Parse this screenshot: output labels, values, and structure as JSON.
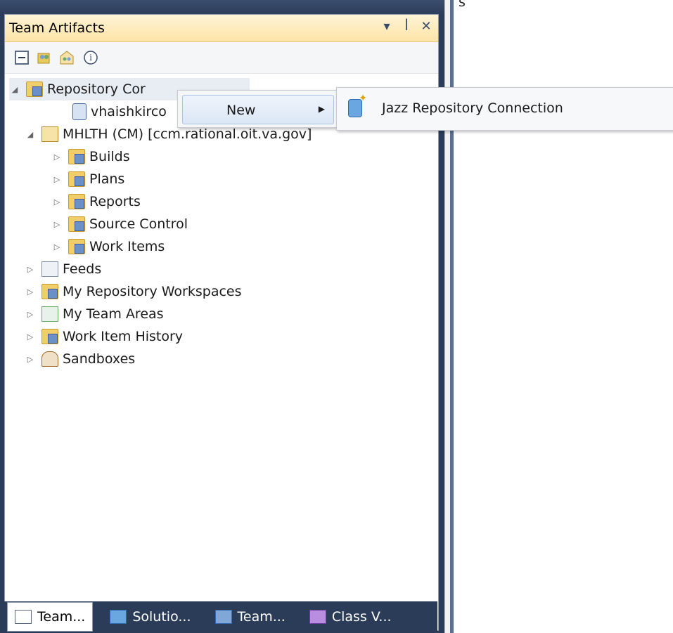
{
  "background": {
    "label": "s"
  },
  "panel": {
    "title": "Team Artifacts",
    "controls": [
      "▾",
      "ꟾ",
      "✕"
    ]
  },
  "toolbar": {
    "buttons": [
      "collapse-all-icon",
      "team-icon",
      "team-area-icon",
      "info-icon"
    ]
  },
  "tree": [
    {
      "label": "Repository Connections",
      "visible_label": "Repository Cor",
      "icon": "folder-icon",
      "expanded": true,
      "level": 0
    },
    {
      "label": "vhaishkirco",
      "icon": "repository-icon",
      "level": 1
    },
    {
      "label": "MHLTH (CM) [ccm.rational.oit.va.gov]",
      "icon": "project-icon",
      "expanded": true,
      "level": 0
    },
    {
      "label": "Builds",
      "icon": "builds-folder-icon",
      "level": 1
    },
    {
      "label": "Plans",
      "icon": "plans-folder-icon",
      "level": 1
    },
    {
      "label": "Reports",
      "icon": "reports-folder-icon",
      "level": 1
    },
    {
      "label": "Source Control",
      "icon": "source-control-folder-icon",
      "level": 1
    },
    {
      "label": "Work Items",
      "icon": "work-items-folder-icon",
      "level": 1
    },
    {
      "label": "Feeds",
      "icon": "feeds-icon",
      "level": 0
    },
    {
      "label": "My Repository Workspaces",
      "icon": "workspaces-icon",
      "level": 0
    },
    {
      "label": "My Team Areas",
      "icon": "team-areas-icon",
      "level": 0
    },
    {
      "label": "Work Item History",
      "icon": "history-icon",
      "level": 0
    },
    {
      "label": "Sandboxes",
      "icon": "sandboxes-icon",
      "level": 0
    }
  ],
  "context_menu": {
    "label": "New",
    "submenu": {
      "label": "Jazz Repository Connection"
    }
  },
  "bottom_tabs": [
    {
      "label": "Team...",
      "icon": "team-tab-icon"
    },
    {
      "label": "Solutio...",
      "icon": "solution-tab-icon"
    },
    {
      "label": "Team...",
      "icon": "team-explorer-tab-icon"
    },
    {
      "label": "Class V...",
      "icon": "class-view-tab-icon"
    }
  ]
}
